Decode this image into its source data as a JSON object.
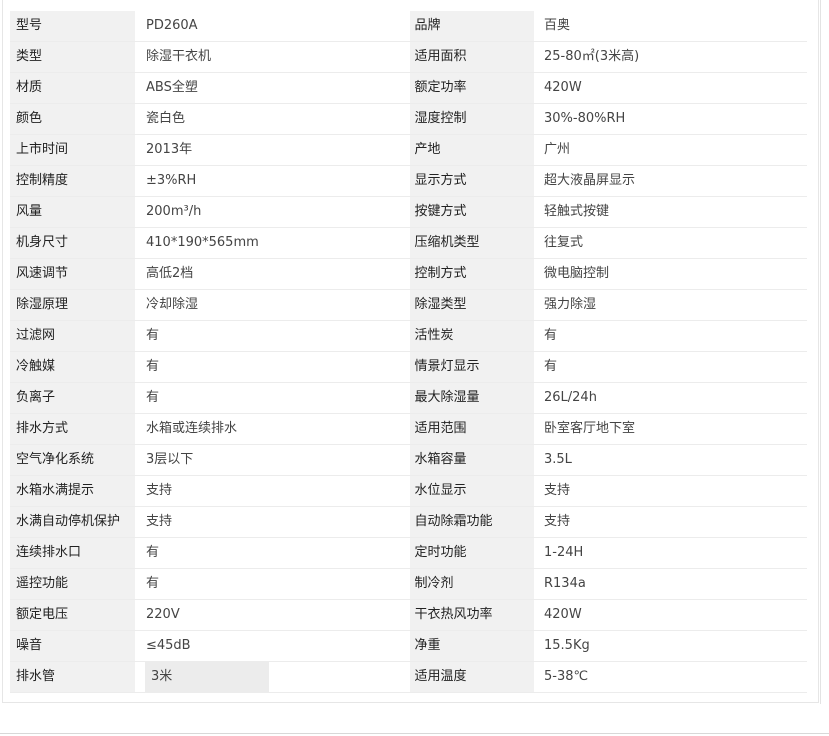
{
  "rows": [
    {
      "l1": "型号",
      "v1": "PD260A",
      "l2": "品牌",
      "v2": "百奥"
    },
    {
      "l1": "类型",
      "v1": "除湿干衣机",
      "l2": "适用面积",
      "v2": "25-80㎡(3米高)"
    },
    {
      "l1": "材质",
      "v1": "ABS全塑",
      "l2": "额定功率",
      "v2": "420W"
    },
    {
      "l1": "颜色",
      "v1": "瓷白色",
      "l2": "湿度控制",
      "v2": "30%-80%RH"
    },
    {
      "l1": "上市时间",
      "v1": "2013年",
      "l2": "产地",
      "v2": "广州"
    },
    {
      "l1": "控制精度",
      "v1": "±3%RH",
      "l2": "显示方式",
      "v2": "超大液晶屏显示"
    },
    {
      "l1": "风量",
      "v1": "200m³/h",
      "l2": "按键方式",
      "v2": "轻触式按键"
    },
    {
      "l1": "机身尺寸",
      "v1": "410*190*565mm",
      "l2": "压缩机类型",
      "v2": "往复式"
    },
    {
      "l1": "风速调节",
      "v1": "高低2档",
      "l2": "控制方式",
      "v2": "微电脑控制"
    },
    {
      "l1": "除湿原理",
      "v1": "冷却除湿",
      "l2": "除湿类型",
      "v2": "强力除湿"
    },
    {
      "l1": "过滤网",
      "v1": "有",
      "l2": "活性炭",
      "v2": "有"
    },
    {
      "l1": "冷触媒",
      "v1": "有",
      "l2": "情景灯显示",
      "v2": "有"
    },
    {
      "l1": "负离子",
      "v1": "有",
      "l2": "最大除湿量",
      "v2": "26L/24h"
    },
    {
      "l1": "排水方式",
      "v1": "水箱或连续排水",
      "l2": "适用范围",
      "v2": "卧室客厅地下室"
    },
    {
      "l1": "空气净化系统",
      "v1": "3层以下",
      "l2": "水箱容量",
      "v2": "3.5L"
    },
    {
      "l1": "水箱水满提示",
      "v1": "支持",
      "l2": "水位显示",
      "v2": "支持"
    },
    {
      "l1": "水满自动停机保护",
      "v1": "支持",
      "l2": "自动除霜功能",
      "v2": "支持"
    },
    {
      "l1": "连续排水口",
      "v1": "有",
      "l2": "定时功能",
      "v2": "1-24H"
    },
    {
      "l1": "遥控功能",
      "v1": "有",
      "l2": "制冷剂",
      "v2": "R134a"
    },
    {
      "l1": "额定电压",
      "v1": "220V",
      "l2": "干衣热风功率",
      "v2": "420W"
    },
    {
      "l1": "噪音",
      "v1": "≤45dB",
      "l2": "净重",
      "v2": "15.5Kg"
    },
    {
      "l1": "排水管",
      "v1": "3米",
      "l2": "适用温度",
      "v2": "5-38℃"
    }
  ]
}
